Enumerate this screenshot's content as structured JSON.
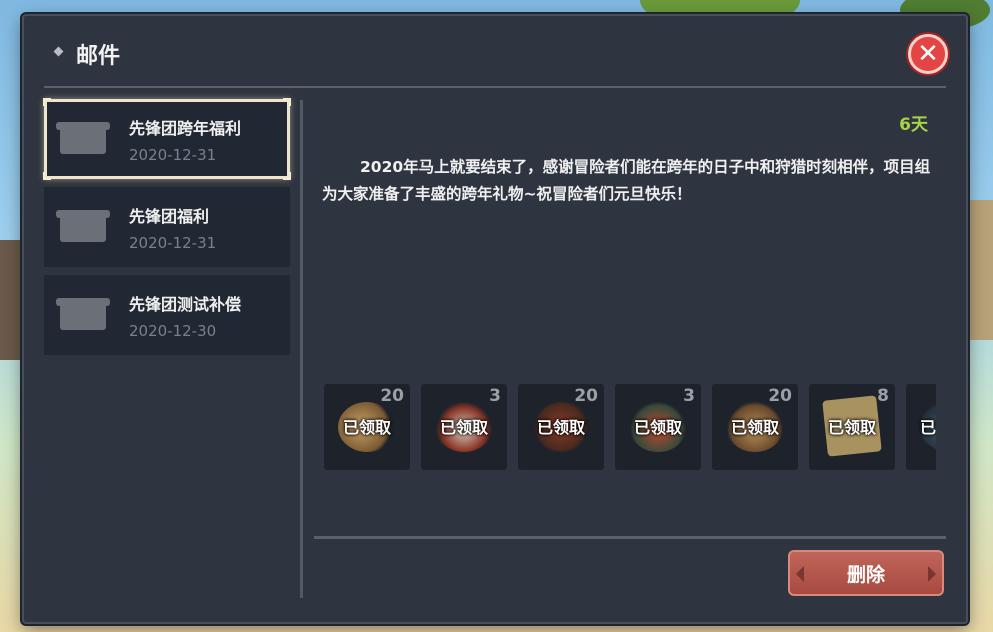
{
  "window": {
    "title": "邮件"
  },
  "mails": [
    {
      "title": "先锋团跨年福利",
      "date": "2020-12-31",
      "selected": true
    },
    {
      "title": "先锋团福利",
      "date": "2020-12-31",
      "selected": false
    },
    {
      "title": "先锋团测试补偿",
      "date": "2020-12-30",
      "selected": false
    }
  ],
  "detail": {
    "days_left": "6天",
    "body": "2020年马上就要结束了，感谢冒险者们能在跨年的日子中和狩猎时刻相伴，项目组为大家准备了丰盛的跨年礼物~祝冒险者们元旦快乐！",
    "claimed_label": "已领取",
    "rewards": [
      {
        "count": "20",
        "icon": "bread-icon"
      },
      {
        "count": "3",
        "icon": "stew-pot-icon"
      },
      {
        "count": "20",
        "icon": "berries-icon"
      },
      {
        "count": "3",
        "icon": "feast-platter-icon"
      },
      {
        "count": "20",
        "icon": "nuts-icon"
      },
      {
        "count": "8",
        "icon": "rug-icon"
      },
      {
        "count": "",
        "icon": "potion-icon"
      }
    ]
  },
  "actions": {
    "delete_label": "删除"
  },
  "colors": {
    "accent_green": "#a5d447",
    "delete_red": "#b3574d",
    "close_red": "#e34545"
  }
}
